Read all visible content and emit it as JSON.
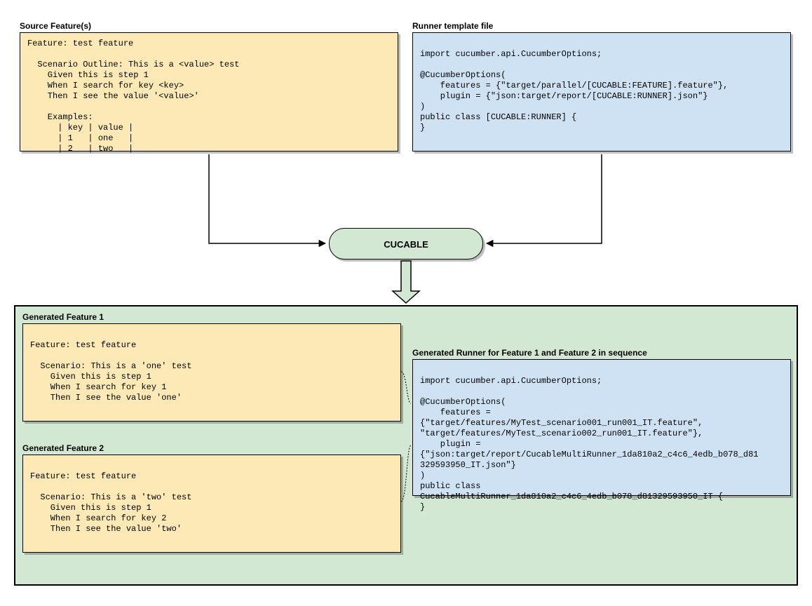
{
  "labels": {
    "sourceFeatures": "Source Feature(s)",
    "runnerTemplate": "Runner template file",
    "genFeature1": "Generated Feature 1",
    "genFeature2": "Generated Feature 2",
    "genRunner": "Generated Runner for Feature 1 and Feature 2 in sequence"
  },
  "cucable": "CUCABLE",
  "code": {
    "sourceFeature": "Feature: test feature\n\n  Scenario Outline: This is a <value> test\n    Given this is step 1\n    When I search for key <key>\n    Then I see the value '<value>'\n\n    Examples:\n      | key | value |\n      | 1   | one   |\n      | 2   | two   |",
    "runnerTemplate": "\nimport cucumber.api.CucumberOptions;\n\n@CucumberOptions(\n    features = {\"target/parallel/[CUCABLE:FEATURE].feature\"},\n    plugin = {\"json:target/report/[CUCABLE:RUNNER].json\"}\n)\npublic class [CUCABLE:RUNNER] {\n}",
    "genFeature1": "\nFeature: test feature\n\n  Scenario: This is a 'one' test\n    Given this is step 1\n    When I search for key 1\n    Then I see the value 'one'",
    "genFeature2": "\nFeature: test feature\n\n  Scenario: This is a 'two' test\n    Given this is step 1\n    When I search for key 2\n    Then I see the value 'two'",
    "genRunner": "\nimport cucumber.api.CucumberOptions;\n\n@CucumberOptions(\n    features =\n{\"target/features/MyTest_scenario001_run001_IT.feature\",\n\"target/features/MyTest_scenario002_run001_IT.feature\"},\n    plugin =\n{\"json:target/report/CucableMultiRunner_1da810a2_c4c6_4edb_b078_d81\n329593950_IT.json\"}\n)\npublic class\nCucableMultiRunner_1da810a2_c4c6_4edb_b078_d81329593950_IT {\n}"
  }
}
